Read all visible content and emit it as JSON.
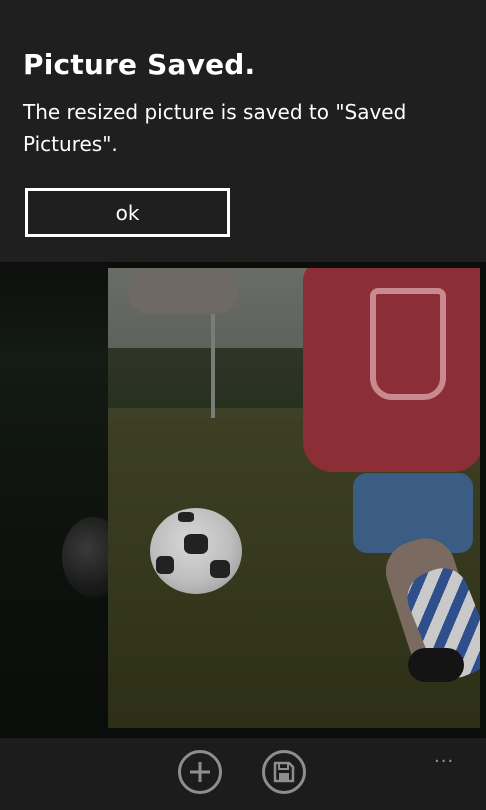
{
  "dialog": {
    "title": "Picture Saved.",
    "message": "The resized picture is saved to \"Saved Pictures\".",
    "ok_label": "ok"
  },
  "appbar": {
    "buttons": [
      {
        "icon": "add-icon"
      },
      {
        "icon": "save-icon"
      }
    ],
    "more_label": "..."
  },
  "colors": {
    "dialog_background": "#1f1f1f",
    "appbar_background": "#1c1c1c",
    "text": "#ffffff"
  }
}
